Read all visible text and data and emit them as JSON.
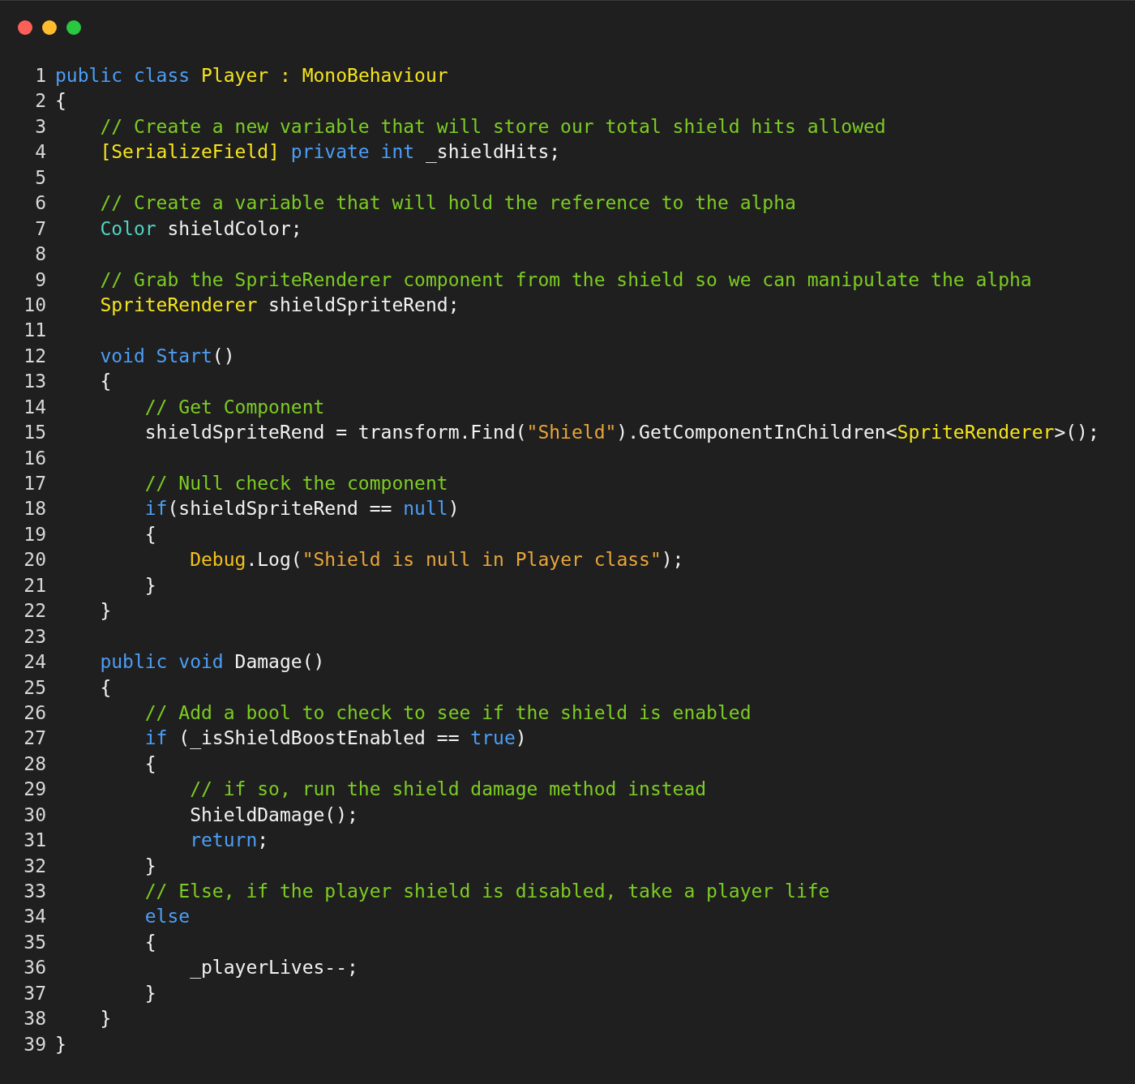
{
  "window": {
    "controls": [
      {
        "kind": "close"
      },
      {
        "kind": "minimize"
      },
      {
        "kind": "zoom"
      }
    ]
  },
  "lines": [
    {
      "number": "1",
      "tokens": [
        {
          "kind": "keyword",
          "text": "public class "
        },
        {
          "kind": "type",
          "text": "Player : MonoBehaviour"
        }
      ]
    },
    {
      "number": "2",
      "tokens": [
        {
          "kind": "plain",
          "text": "{"
        }
      ]
    },
    {
      "number": "3",
      "tokens": [
        {
          "kind": "comment",
          "text": "    // Create a new variable that will store our total shield hits allowed"
        }
      ]
    },
    {
      "number": "4",
      "tokens": [
        {
          "kind": "type",
          "text": "    [SerializeField] "
        },
        {
          "kind": "keyword",
          "text": "private int "
        },
        {
          "kind": "plain",
          "text": "_shieldHits;"
        }
      ]
    },
    {
      "number": "5"
    },
    {
      "number": "6",
      "tokens": [
        {
          "kind": "comment",
          "text": "    // Create a variable that will hold the reference to the alpha"
        }
      ]
    },
    {
      "number": "7",
      "tokens": [
        {
          "kind": "struct",
          "text": "    Color "
        },
        {
          "kind": "plain",
          "text": "shieldColor;"
        }
      ]
    },
    {
      "number": "8"
    },
    {
      "number": "9",
      "tokens": [
        {
          "kind": "comment",
          "text": "    // Grab the SpriteRenderer component from the shield so we can manipulate the alpha"
        }
      ]
    },
    {
      "number": "10",
      "tokens": [
        {
          "kind": "type",
          "text": "    SpriteRenderer "
        },
        {
          "kind": "plain",
          "text": "shieldSpriteRend;"
        }
      ]
    },
    {
      "number": "11"
    },
    {
      "number": "12",
      "tokens": [
        {
          "kind": "keyword",
          "text": "    void Start"
        },
        {
          "kind": "plain",
          "text": "()"
        }
      ]
    },
    {
      "number": "13",
      "tokens": [
        {
          "kind": "plain",
          "text": "    {"
        }
      ]
    },
    {
      "number": "14",
      "tokens": [
        {
          "kind": "comment",
          "text": "        // Get Component"
        }
      ]
    },
    {
      "number": "15",
      "tokens": [
        {
          "kind": "plain",
          "text": "        shieldSpriteRend = transform.Find("
        },
        {
          "kind": "string",
          "text": "\"Shield\""
        },
        {
          "kind": "plain",
          "text": ").GetComponentInChildren<"
        },
        {
          "kind": "type",
          "text": "SpriteRenderer"
        },
        {
          "kind": "plain",
          "text": ">();"
        }
      ]
    },
    {
      "number": "16"
    },
    {
      "number": "17",
      "tokens": [
        {
          "kind": "comment",
          "text": "        // Null check the component"
        }
      ]
    },
    {
      "number": "18",
      "tokens": [
        {
          "kind": "keyword",
          "text": "        if"
        },
        {
          "kind": "plain",
          "text": "(shieldSpriteRend == "
        },
        {
          "kind": "keyword",
          "text": "null"
        },
        {
          "kind": "plain",
          "text": ")"
        }
      ]
    },
    {
      "number": "19",
      "tokens": [
        {
          "kind": "plain",
          "text": "        {"
        }
      ]
    },
    {
      "number": "20",
      "tokens": [
        {
          "kind": "class",
          "text": "            Debug"
        },
        {
          "kind": "plain",
          "text": ".Log("
        },
        {
          "kind": "string",
          "text": "\"Shield is null in Player class\""
        },
        {
          "kind": "plain",
          "text": ");"
        }
      ]
    },
    {
      "number": "21",
      "tokens": [
        {
          "kind": "plain",
          "text": "        }"
        }
      ]
    },
    {
      "number": "22",
      "tokens": [
        {
          "kind": "plain",
          "text": "    }"
        }
      ]
    },
    {
      "number": "23"
    },
    {
      "number": "24",
      "tokens": [
        {
          "kind": "keyword",
          "text": "    public void "
        },
        {
          "kind": "plain",
          "text": "Damage()"
        }
      ]
    },
    {
      "number": "25",
      "tokens": [
        {
          "kind": "plain",
          "text": "    {"
        }
      ]
    },
    {
      "number": "26",
      "tokens": [
        {
          "kind": "comment",
          "text": "        // Add a bool to check to see if the shield is enabled"
        }
      ]
    },
    {
      "number": "27",
      "tokens": [
        {
          "kind": "keyword",
          "text": "        if "
        },
        {
          "kind": "plain",
          "text": "(_isShieldBoostEnabled == "
        },
        {
          "kind": "keyword",
          "text": "true"
        },
        {
          "kind": "plain",
          "text": ")"
        }
      ]
    },
    {
      "number": "28",
      "tokens": [
        {
          "kind": "plain",
          "text": "        {"
        }
      ]
    },
    {
      "number": "29",
      "tokens": [
        {
          "kind": "comment",
          "text": "            // if so, run the shield damage method instead"
        }
      ]
    },
    {
      "number": "30",
      "tokens": [
        {
          "kind": "plain",
          "text": "            ShieldDamage();"
        }
      ]
    },
    {
      "number": "31",
      "tokens": [
        {
          "kind": "keyword",
          "text": "            return"
        },
        {
          "kind": "plain",
          "text": ";"
        }
      ]
    },
    {
      "number": "32",
      "tokens": [
        {
          "kind": "plain",
          "text": "        }"
        }
      ]
    },
    {
      "number": "33",
      "tokens": [
        {
          "kind": "comment",
          "text": "        // Else, if the player shield is disabled, take a player life"
        }
      ]
    },
    {
      "number": "34",
      "tokens": [
        {
          "kind": "keyword",
          "text": "        else"
        }
      ]
    },
    {
      "number": "35",
      "tokens": [
        {
          "kind": "plain",
          "text": "        {"
        }
      ]
    },
    {
      "number": "36",
      "tokens": [
        {
          "kind": "plain",
          "text": "            _playerLives--;"
        }
      ]
    },
    {
      "number": "37",
      "tokens": [
        {
          "kind": "plain",
          "text": "        }"
        }
      ]
    },
    {
      "number": "38",
      "tokens": [
        {
          "kind": "plain",
          "text": "    }"
        }
      ]
    },
    {
      "number": "39",
      "tokens": [
        {
          "kind": "plain",
          "text": "}"
        }
      ]
    }
  ]
}
